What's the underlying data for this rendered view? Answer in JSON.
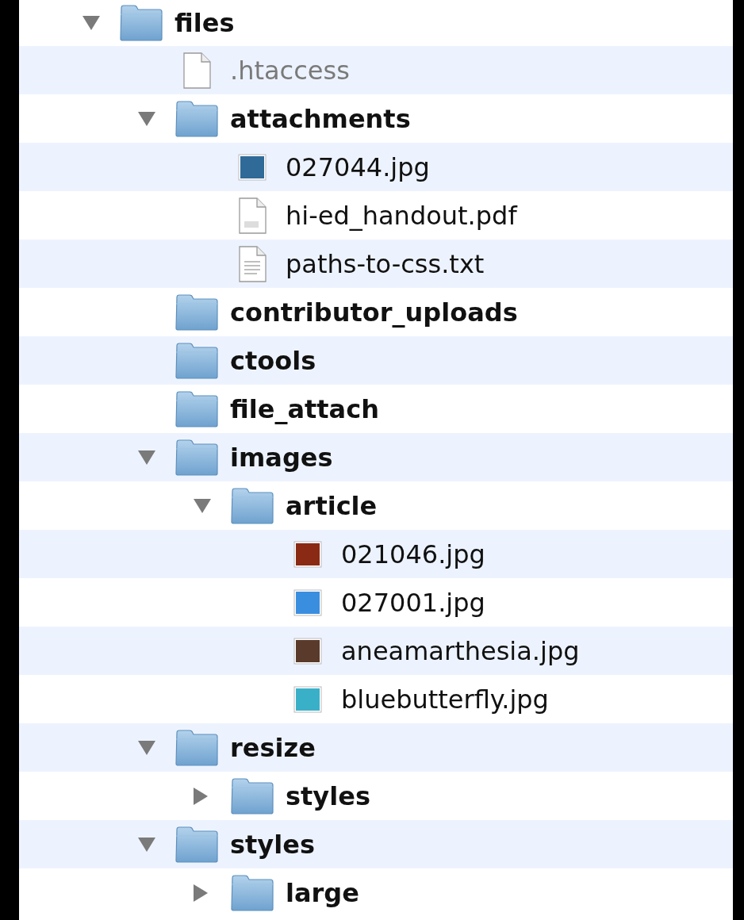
{
  "tree": [
    {
      "name": "files",
      "kind": "folder",
      "expanded": true,
      "children": [
        {
          "name": ".htaccess",
          "kind": "file",
          "hidden": true
        },
        {
          "name": "attachments",
          "kind": "folder",
          "expanded": true,
          "children": [
            {
              "name": "027044.jpg",
              "kind": "image",
              "color": "#2f6a98"
            },
            {
              "name": "hi-ed_handout.pdf",
              "kind": "pdf"
            },
            {
              "name": "paths-to-css.txt",
              "kind": "text"
            }
          ]
        },
        {
          "name": "contributor_uploads",
          "kind": "folder"
        },
        {
          "name": "ctools",
          "kind": "folder"
        },
        {
          "name": "file_attach",
          "kind": "folder"
        },
        {
          "name": "images",
          "kind": "folder",
          "expanded": true,
          "children": [
            {
              "name": "article",
              "kind": "folder",
              "expanded": true,
              "children": [
                {
                  "name": "021046.jpg",
                  "kind": "image",
                  "color": "#8a2a14"
                },
                {
                  "name": "027001.jpg",
                  "kind": "image",
                  "color": "#3a8ee0"
                },
                {
                  "name": "aneamarthesia.jpg",
                  "kind": "image",
                  "color": "#5a3a2a"
                },
                {
                  "name": "bluebutterfly.jpg",
                  "kind": "image",
                  "color": "#3ab0c8"
                }
              ]
            }
          ]
        },
        {
          "name": "resize",
          "kind": "folder",
          "expanded": true,
          "children": [
            {
              "name": "styles",
              "kind": "folder",
              "expanded": false
            }
          ]
        },
        {
          "name": "styles",
          "kind": "folder",
          "expanded": true,
          "children": [
            {
              "name": "large",
              "kind": "folder",
              "expanded": false
            }
          ]
        }
      ]
    }
  ]
}
